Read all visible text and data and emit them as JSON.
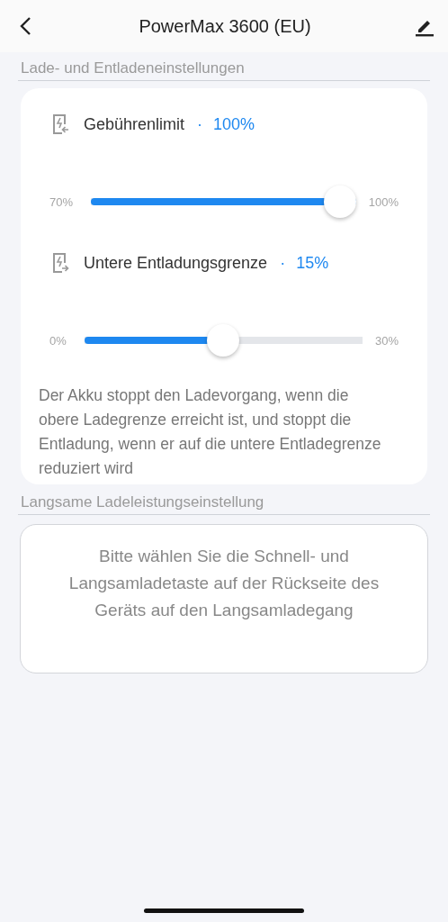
{
  "header": {
    "title": "PowerMax 3600 (EU)"
  },
  "sections": [
    {
      "title": "Lade- und Entladeneinstellungen",
      "kind": "sliders",
      "limits": [
        {
          "label": "Gebührenlimit",
          "separator": "·",
          "value": "100%",
          "min_label": "70%",
          "max_label": "100%",
          "level": 1.0,
          "kind": "charge"
        },
        {
          "label": "Untere Entladungsgrenze",
          "separator": "·",
          "value": "15%",
          "min_label": "0%",
          "max_label": "30%",
          "level": 0.5,
          "kind": "discharge"
        }
      ],
      "note": "Der Akku stoppt den Ladevorgang, wenn die obere Ladegrenze erreicht ist, und stoppt die Entladung, wenn er auf die untere Entladegrenze reduziert wird"
    },
    {
      "title": "Langsame Ladeleistungseinstellung",
      "kind": "message",
      "message": "Bitte wählen Sie die Schnell- und Langsamladetaste auf der Rückseite des Geräts auf den Langsamladegang"
    }
  ]
}
